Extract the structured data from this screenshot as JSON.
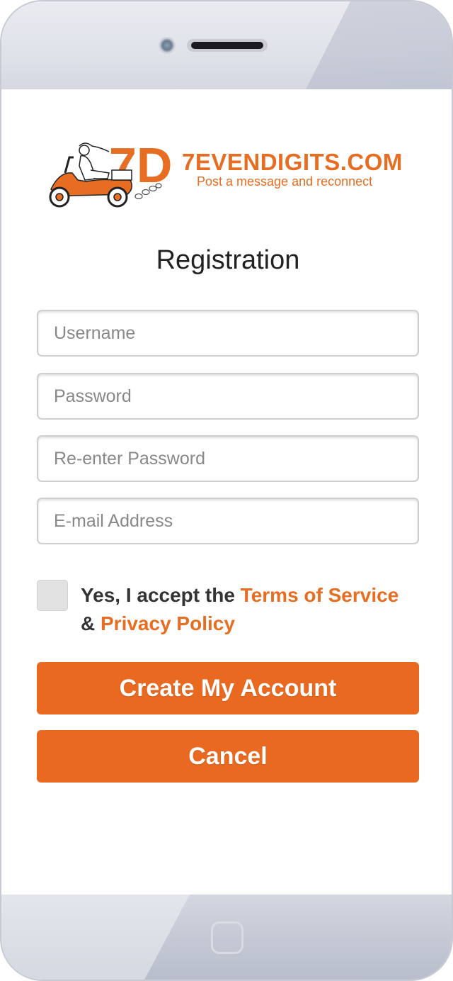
{
  "logo": {
    "brand": "7EVENDIGITS.COM",
    "tagline": "Post a message and reconnect",
    "mark": "7D"
  },
  "page": {
    "title": "Registration"
  },
  "form": {
    "username_placeholder": "Username",
    "password_placeholder": "Password",
    "reenter_placeholder": "Re-enter Password",
    "email_placeholder": "E-mail Address"
  },
  "terms": {
    "prefix": "Yes, I accept the ",
    "tos": "Terms of Service",
    "amp": "& ",
    "privacy": "Privacy Policy",
    "checked": false
  },
  "buttons": {
    "create": "Create My Account",
    "cancel": "Cancel"
  },
  "colors": {
    "accent": "#e8691f",
    "text": "#222222"
  },
  "icons": [
    "camera-icon",
    "speaker-icon",
    "home-button-icon",
    "scooter-logo-icon"
  ]
}
